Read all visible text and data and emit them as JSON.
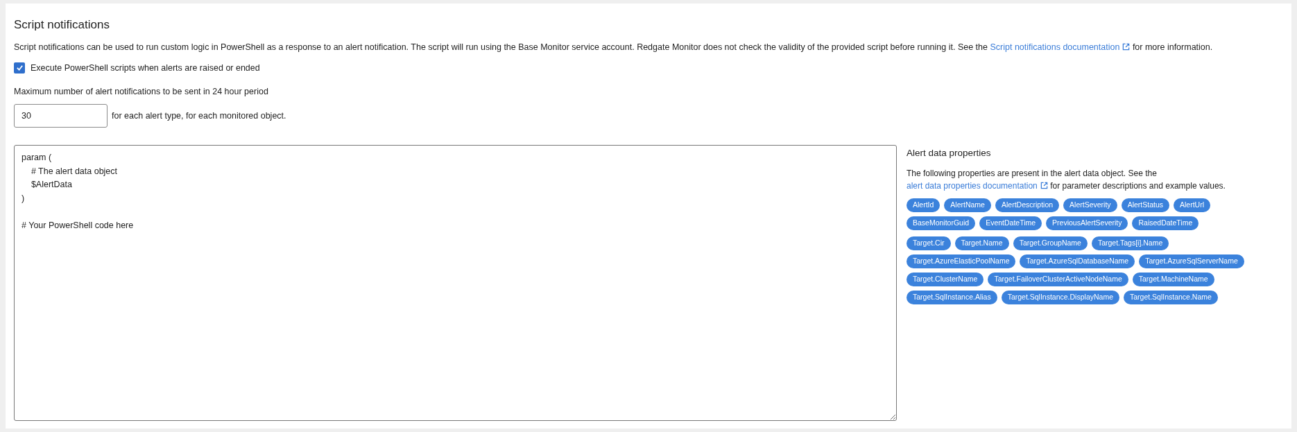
{
  "title": "Script notifications",
  "description": {
    "before": "Script notifications can be used to run custom logic in PowerShell as a response to an alert notification. The script will run using the Base Monitor service account. Redgate Monitor does not check the validity of the provided script before running it. See the",
    "link": "Script notifications documentation",
    "after": "for more information."
  },
  "execute_checkbox": {
    "label": "Execute PowerShell scripts when alerts are raised or ended",
    "checked": true
  },
  "max_notifications": {
    "label": "Maximum number of alert notifications to be sent in 24 hour period",
    "value": "30",
    "suffix": "for each alert type, for each monitored object."
  },
  "script_editor": {
    "blocks": [
      [
        "param (",
        "    # The alert data object",
        "    $AlertData",
        ")"
      ],
      [
        "# Your PowerShell code here"
      ]
    ]
  },
  "properties_panel": {
    "title": "Alert data properties",
    "intro": "The following properties are present in the alert data object. See the",
    "link": "alert data properties documentation",
    "after": "for parameter descriptions and example values.",
    "groups": [
      {
        "chips": [
          "AlertId",
          "AlertName",
          "AlertDescription",
          "AlertSeverity",
          "AlertStatus",
          "AlertUrl",
          "BaseMonitorGuid",
          "EventDateTime",
          "PreviousAlertSeverity",
          "RaisedDateTime"
        ]
      },
      {
        "chips": [
          "Target.Cir",
          "Target.Name",
          "Target.GroupName",
          "Target.Tags[i].Name",
          "Target.AzureElasticPoolName",
          "Target.AzureSqlDatabaseName",
          "Target.AzureSqlServerName",
          "Target.ClusterName",
          "Target.FailoverClusterActiveNodeName",
          "Target.MachineName",
          "Target.SqlInstance.Alias",
          "Target.SqlInstance.DisplayName",
          "Target.SqlInstance.Name"
        ]
      }
    ]
  }
}
